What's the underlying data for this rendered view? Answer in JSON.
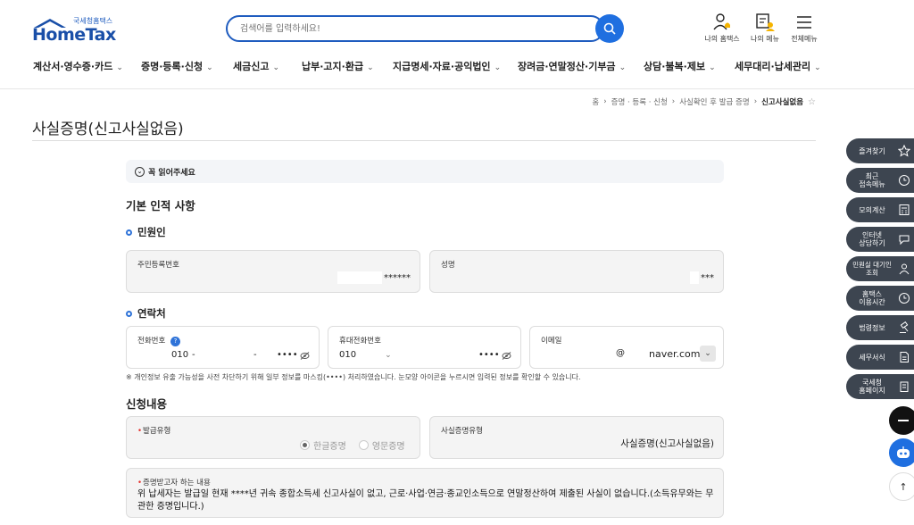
{
  "header": {
    "logo_sub": "국세청홈택스",
    "logo_main": "HomeTax",
    "search_placeholder": "검색어를 입력하세요!",
    "icons": [
      {
        "label": "나의 홈택스"
      },
      {
        "label": "나의 메뉴"
      },
      {
        "label": "전체메뉴"
      }
    ]
  },
  "gnb": [
    {
      "label": "계산서·영수증·카드"
    },
    {
      "label": "증명·등록·신청"
    },
    {
      "label": "세금신고"
    },
    {
      "label": "납부·고지·환급"
    },
    {
      "label": "지급명세·자료·공익법인"
    },
    {
      "label": "장려금·연말정산·기부금"
    },
    {
      "label": "상담·불복·제보"
    },
    {
      "label": "세무대리·납세관리"
    }
  ],
  "breadcrumb": {
    "items": [
      "홈",
      "증명 · 등록 · 신청",
      "사실확인 후 발급 증명"
    ],
    "current": "신고사실없음"
  },
  "page": {
    "title": "사실증명(신고사실없음)",
    "notice": "꼭 읽어주세요"
  },
  "basic": {
    "heading": "기본 인적 사항",
    "applicant_heading": "민원인",
    "resident_label": "주민등록번호",
    "resident_value": "******",
    "name_label": "성명",
    "name_value": "***"
  },
  "contact": {
    "heading": "연락처",
    "phone_label": "전화번호",
    "phone_badge": "?",
    "phone_area": "010",
    "phone_dash1": "-",
    "phone_dash2": "-",
    "phone_last": "••••",
    "mobile_label": "휴대전화번호",
    "mobile_area": "010",
    "mobile_last": "••••",
    "email_label": "이메일",
    "email_at": "@",
    "email_domain": "naver.com"
  },
  "note": "※ 개인정보 유출 가능성을 사전 차단하기 위해 일부 정보를 마스킹(••••) 처리하였습니다. 눈모양 아이콘을 누르시면 입력된 정보를 확인할 수 있습니다.",
  "application": {
    "heading": "신청내용",
    "issue_type_label": "발급유형",
    "issue_type_options": [
      "한글증명",
      "영문증명"
    ],
    "cert_type_label": "사실증명유형",
    "cert_type_value": "사실증명(신고사실없음)",
    "content_label": "증명받고자 하는 내용",
    "content_text": "위 납세자는 발급일 현재 ****년 귀속 종합소득세 신고사실이 없고, 근로·사업·연금·종교인소득으로 연말정산하여 제출된 사실이 없습니다.(소득유무와는 무관한 증명입니다.)"
  },
  "side_menu": [
    {
      "label": "즐겨찾기"
    },
    {
      "label": "최근\n접속메뉴"
    },
    {
      "label": "모의계산"
    },
    {
      "label": "인터넷\n상담하기"
    },
    {
      "label": "민원실 대기인\n조회"
    },
    {
      "label": "홈택스\n이용시간"
    },
    {
      "label": "법령정보"
    },
    {
      "label": "세무서식"
    },
    {
      "label": "국세청\n홈페이지"
    }
  ],
  "colors": {
    "brand": "#1a4fa8",
    "accent": "#1f6fe0",
    "side_bg": "#3d4550",
    "required": "#e5332f"
  }
}
